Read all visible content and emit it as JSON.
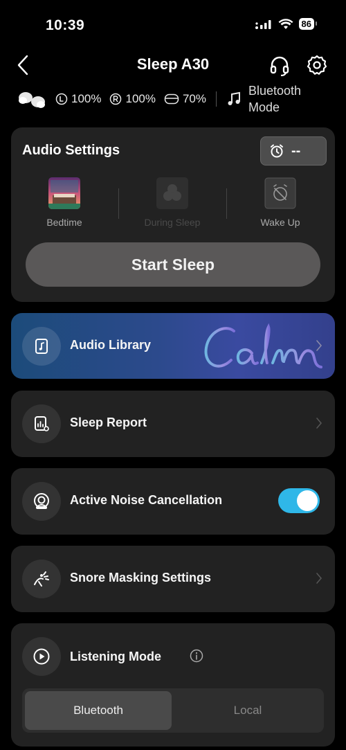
{
  "status_bar": {
    "time": "10:39",
    "battery": "86"
  },
  "header": {
    "title": "Sleep A30"
  },
  "device": {
    "left_battery": "100%",
    "right_battery": "100%",
    "case_battery": "70%",
    "mode": "Bluetooth Mode"
  },
  "audio_settings": {
    "title": "Audio Settings",
    "alarm_value": "--",
    "phases": [
      {
        "label": "Bedtime"
      },
      {
        "label": "During Sleep"
      },
      {
        "label": "Wake Up"
      }
    ],
    "start_button": "Start Sleep"
  },
  "rows": {
    "audio_library": "Audio Library",
    "sleep_report": "Sleep Report",
    "anc": "Active Noise Cancellation",
    "anc_enabled": true,
    "snore": "Snore Masking Settings"
  },
  "listening_mode": {
    "title": "Listening Mode",
    "options": [
      "Bluetooth",
      "Local"
    ],
    "selected": "Bluetooth"
  },
  "brand": {
    "partner_logo": "Calm"
  },
  "colors": {
    "accent": "#2fb7e8",
    "card": "#222222",
    "library_gradient_start": "#1c4b7a",
    "library_gradient_end": "#3a4aa0"
  }
}
